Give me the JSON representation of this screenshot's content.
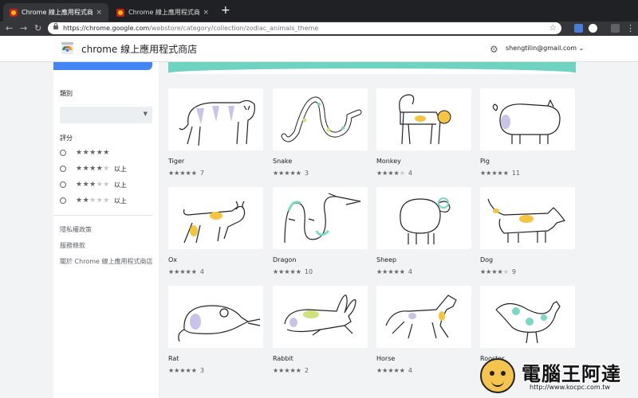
{
  "browser": {
    "tabs": [
      {
        "title": "Chrome 線上應用程式商店 - 十",
        "close": "×"
      },
      {
        "title": "Chrome 線上應用程式商店 - Ch",
        "close": "×"
      }
    ],
    "new_tab": "+",
    "url_host": "https://chrome.google.com",
    "url_path": "/webstore/category/collection/zodiac_animals_theme",
    "icons": [
      "back-arrow-icon",
      "forward-arrow-icon",
      "reload-icon",
      "lock-icon",
      "bookmark-star-icon",
      "extension-icon",
      "menu-dots-icon"
    ]
  },
  "header": {
    "title": "chrome 線上應用程式商店",
    "account": "shengtilin@gmail.com",
    "account_caret": "⌄"
  },
  "sidebar": {
    "category_label": "類別",
    "category_select_value": "",
    "rating_label": "評分",
    "ratings": [
      {
        "stars": "★★★★★",
        "empty": "",
        "suffix": ""
      },
      {
        "stars": "★★★★",
        "empty": "★",
        "suffix": "以上"
      },
      {
        "stars": "★★★",
        "empty": "★★",
        "suffix": "以上"
      },
      {
        "stars": "★★",
        "empty": "★★★",
        "suffix": "以上"
      }
    ],
    "links": [
      "隱私權政策",
      "服務條款",
      "關於 Chrome 線上應用程式商店"
    ]
  },
  "themes": [
    {
      "name": "Tiger",
      "stars": "★★★★★",
      "empty": "",
      "count": "7"
    },
    {
      "name": "Snake",
      "stars": "★★★★★",
      "empty": "",
      "count": "3"
    },
    {
      "name": "Monkey",
      "stars": "★★★★",
      "empty": "★",
      "count": "4"
    },
    {
      "name": "Pig",
      "stars": "★★★★★",
      "empty": "",
      "count": "11"
    },
    {
      "name": "Ox",
      "stars": "★★★★★",
      "empty": "",
      "count": "4"
    },
    {
      "name": "Dragon",
      "stars": "★★★★★",
      "empty": "",
      "count": "10"
    },
    {
      "name": "Sheep",
      "stars": "★★★★★",
      "empty": "",
      "count": "4"
    },
    {
      "name": "Dog",
      "stars": "★★★★",
      "empty": "★",
      "count": "9"
    },
    {
      "name": "Rat",
      "stars": "★★★★★",
      "empty": "",
      "count": "3"
    },
    {
      "name": "Rabbit",
      "stars": "★★★★★",
      "empty": "",
      "count": "2"
    },
    {
      "name": "Horse",
      "stars": "★★★★★",
      "empty": "",
      "count": "4"
    },
    {
      "name": "Rooster",
      "stars": "★★★★★",
      "empty": "",
      "count": ""
    }
  ],
  "watermark": {
    "text": "電腦王阿達",
    "url": "http://www.kocpc.com.tw"
  },
  "colors": {
    "accent_blue": "#4285f4",
    "banner_teal": "#6fd3c1",
    "tab_bar": "#202124"
  }
}
